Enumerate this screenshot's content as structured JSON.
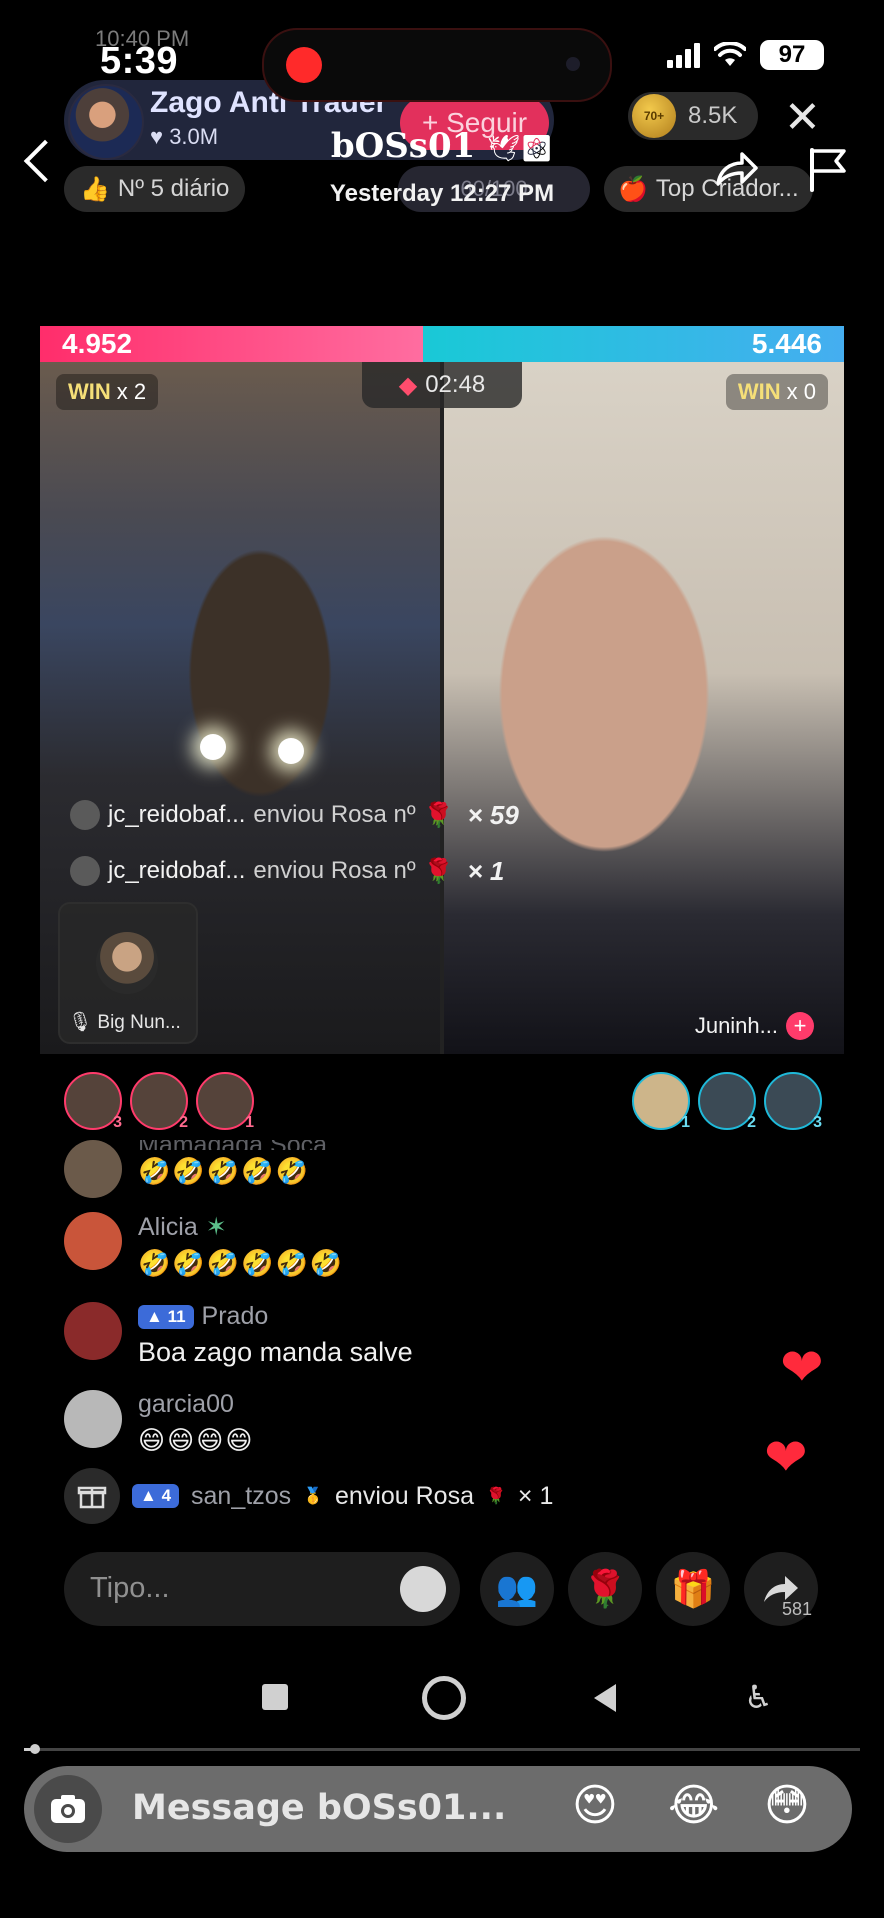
{
  "status_bar": {
    "time": "5:39",
    "battery": "97",
    "underlay_text": "10:40 PM"
  },
  "live": {
    "host_name": "Zago Anti Trader",
    "host_likes": "3.0M",
    "follow_label": "+ Seguir",
    "coins": "8.5K",
    "coin_badge": "70+",
    "close_icon": "close-icon",
    "rank_label": "Nº 5 diário",
    "mid_pill": "60/100",
    "top_label": "Top Criador..."
  },
  "story": {
    "title": "bOSs01",
    "subtitle": "Yesterday 12:27 PM"
  },
  "battle": {
    "left_score": "4.952",
    "right_score": "5.446",
    "left_share": 0.476,
    "timer": "02:48",
    "left_win_label": "WIN",
    "left_win_mult": "x 2",
    "right_win_label": "WIN",
    "right_win_mult": "x 0",
    "gift_lines": [
      {
        "user": "jc_reidobaf...",
        "text": "enviou Rosa nº",
        "count": "× 59"
      },
      {
        "user": "jc_reidobaf...",
        "text": "enviou Rosa nº",
        "count": "× 1"
      }
    ],
    "guest_name": "Big Nun...",
    "right_name": "Juninh..."
  },
  "ranks": {
    "left": [
      "3",
      "2",
      "1"
    ],
    "right": [
      "1",
      "2",
      "3"
    ]
  },
  "chat": [
    {
      "name": "Mamadada Soca",
      "text": "🤣🤣🤣🤣🤣",
      "level": ""
    },
    {
      "name": "Alicia",
      "text": "🤣🤣🤣🤣🤣🤣",
      "level": ""
    },
    {
      "name": "Prado",
      "text": "Boa zago manda salve",
      "level": "11"
    },
    {
      "name": "garcia00",
      "text": "😄😄😄😄",
      "level": ""
    }
  ],
  "gift_notice": {
    "level": "4",
    "user": "san_tzos",
    "text": "enviou Rosa",
    "count": "× 1"
  },
  "input": {
    "placeholder": "Tipo...",
    "share_count": "581"
  },
  "reply": {
    "placeholder": "Message bOSs01...",
    "quick_reactions": [
      "😍",
      "😂",
      "😳"
    ]
  },
  "colors": {
    "pink": "#ff2d6b",
    "cyan": "#19c9d6",
    "win_gold": "#f5df78",
    "heart": "#ff2a3c"
  }
}
